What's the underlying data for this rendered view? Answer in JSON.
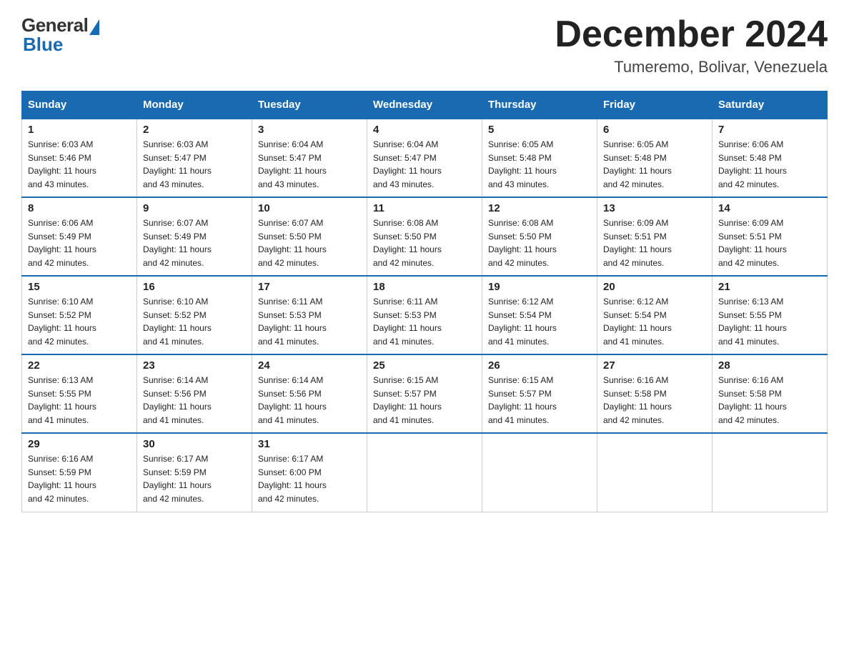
{
  "header": {
    "logo_general": "General",
    "logo_blue": "Blue",
    "month_title": "December 2024",
    "location": "Tumeremo, Bolivar, Venezuela"
  },
  "weekdays": [
    "Sunday",
    "Monday",
    "Tuesday",
    "Wednesday",
    "Thursday",
    "Friday",
    "Saturday"
  ],
  "weeks": [
    [
      {
        "day": 1,
        "sunrise": "6:03 AM",
        "sunset": "5:46 PM",
        "daylight": "11 hours and 43 minutes."
      },
      {
        "day": 2,
        "sunrise": "6:03 AM",
        "sunset": "5:47 PM",
        "daylight": "11 hours and 43 minutes."
      },
      {
        "day": 3,
        "sunrise": "6:04 AM",
        "sunset": "5:47 PM",
        "daylight": "11 hours and 43 minutes."
      },
      {
        "day": 4,
        "sunrise": "6:04 AM",
        "sunset": "5:47 PM",
        "daylight": "11 hours and 43 minutes."
      },
      {
        "day": 5,
        "sunrise": "6:05 AM",
        "sunset": "5:48 PM",
        "daylight": "11 hours and 43 minutes."
      },
      {
        "day": 6,
        "sunrise": "6:05 AM",
        "sunset": "5:48 PM",
        "daylight": "11 hours and 42 minutes."
      },
      {
        "day": 7,
        "sunrise": "6:06 AM",
        "sunset": "5:48 PM",
        "daylight": "11 hours and 42 minutes."
      }
    ],
    [
      {
        "day": 8,
        "sunrise": "6:06 AM",
        "sunset": "5:49 PM",
        "daylight": "11 hours and 42 minutes."
      },
      {
        "day": 9,
        "sunrise": "6:07 AM",
        "sunset": "5:49 PM",
        "daylight": "11 hours and 42 minutes."
      },
      {
        "day": 10,
        "sunrise": "6:07 AM",
        "sunset": "5:50 PM",
        "daylight": "11 hours and 42 minutes."
      },
      {
        "day": 11,
        "sunrise": "6:08 AM",
        "sunset": "5:50 PM",
        "daylight": "11 hours and 42 minutes."
      },
      {
        "day": 12,
        "sunrise": "6:08 AM",
        "sunset": "5:50 PM",
        "daylight": "11 hours and 42 minutes."
      },
      {
        "day": 13,
        "sunrise": "6:09 AM",
        "sunset": "5:51 PM",
        "daylight": "11 hours and 42 minutes."
      },
      {
        "day": 14,
        "sunrise": "6:09 AM",
        "sunset": "5:51 PM",
        "daylight": "11 hours and 42 minutes."
      }
    ],
    [
      {
        "day": 15,
        "sunrise": "6:10 AM",
        "sunset": "5:52 PM",
        "daylight": "11 hours and 42 minutes."
      },
      {
        "day": 16,
        "sunrise": "6:10 AM",
        "sunset": "5:52 PM",
        "daylight": "11 hours and 41 minutes."
      },
      {
        "day": 17,
        "sunrise": "6:11 AM",
        "sunset": "5:53 PM",
        "daylight": "11 hours and 41 minutes."
      },
      {
        "day": 18,
        "sunrise": "6:11 AM",
        "sunset": "5:53 PM",
        "daylight": "11 hours and 41 minutes."
      },
      {
        "day": 19,
        "sunrise": "6:12 AM",
        "sunset": "5:54 PM",
        "daylight": "11 hours and 41 minutes."
      },
      {
        "day": 20,
        "sunrise": "6:12 AM",
        "sunset": "5:54 PM",
        "daylight": "11 hours and 41 minutes."
      },
      {
        "day": 21,
        "sunrise": "6:13 AM",
        "sunset": "5:55 PM",
        "daylight": "11 hours and 41 minutes."
      }
    ],
    [
      {
        "day": 22,
        "sunrise": "6:13 AM",
        "sunset": "5:55 PM",
        "daylight": "11 hours and 41 minutes."
      },
      {
        "day": 23,
        "sunrise": "6:14 AM",
        "sunset": "5:56 PM",
        "daylight": "11 hours and 41 minutes."
      },
      {
        "day": 24,
        "sunrise": "6:14 AM",
        "sunset": "5:56 PM",
        "daylight": "11 hours and 41 minutes."
      },
      {
        "day": 25,
        "sunrise": "6:15 AM",
        "sunset": "5:57 PM",
        "daylight": "11 hours and 41 minutes."
      },
      {
        "day": 26,
        "sunrise": "6:15 AM",
        "sunset": "5:57 PM",
        "daylight": "11 hours and 41 minutes."
      },
      {
        "day": 27,
        "sunrise": "6:16 AM",
        "sunset": "5:58 PM",
        "daylight": "11 hours and 42 minutes."
      },
      {
        "day": 28,
        "sunrise": "6:16 AM",
        "sunset": "5:58 PM",
        "daylight": "11 hours and 42 minutes."
      }
    ],
    [
      {
        "day": 29,
        "sunrise": "6:16 AM",
        "sunset": "5:59 PM",
        "daylight": "11 hours and 42 minutes."
      },
      {
        "day": 30,
        "sunrise": "6:17 AM",
        "sunset": "5:59 PM",
        "daylight": "11 hours and 42 minutes."
      },
      {
        "day": 31,
        "sunrise": "6:17 AM",
        "sunset": "6:00 PM",
        "daylight": "11 hours and 42 minutes."
      },
      null,
      null,
      null,
      null
    ]
  ],
  "labels": {
    "sunrise": "Sunrise:",
    "sunset": "Sunset:",
    "daylight": "Daylight:"
  }
}
